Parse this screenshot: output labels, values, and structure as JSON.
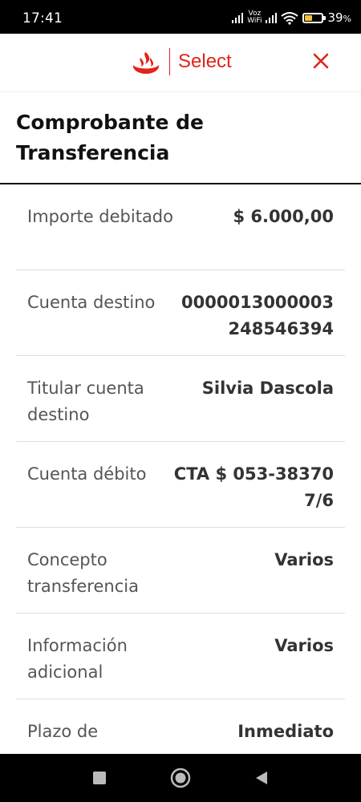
{
  "status_bar": {
    "time": "17:41",
    "voz_label": "Voz",
    "wifi_label": "WiFi",
    "battery_percent": "39",
    "battery_suffix": "%",
    "battery_level": 0.39
  },
  "header": {
    "brand_text": "Select",
    "brand_color": "#e2231a",
    "close_icon": "close-icon"
  },
  "page": {
    "title_line1": "Comprobante de",
    "title_line2": "Transferencia"
  },
  "rows": [
    {
      "label": "Importe debitado",
      "value": "$ 6.000,00"
    },
    {
      "label": "Cuenta destino",
      "value": "0000013000003248546394"
    },
    {
      "label": "Titular cuenta destino",
      "value": "Silvia Dascola"
    },
    {
      "label": "Cuenta débito",
      "value": "CTA $ 053-383707/6"
    },
    {
      "label": "Concepto transferencia",
      "value": "Varios"
    },
    {
      "label": "Información adicional",
      "value": "Varios"
    },
    {
      "label": "Plazo de",
      "value": "Inmediato"
    }
  ],
  "nav": {
    "recents_icon": "square-icon",
    "home_icon": "circle-icon",
    "back_icon": "triangle-back-icon"
  }
}
